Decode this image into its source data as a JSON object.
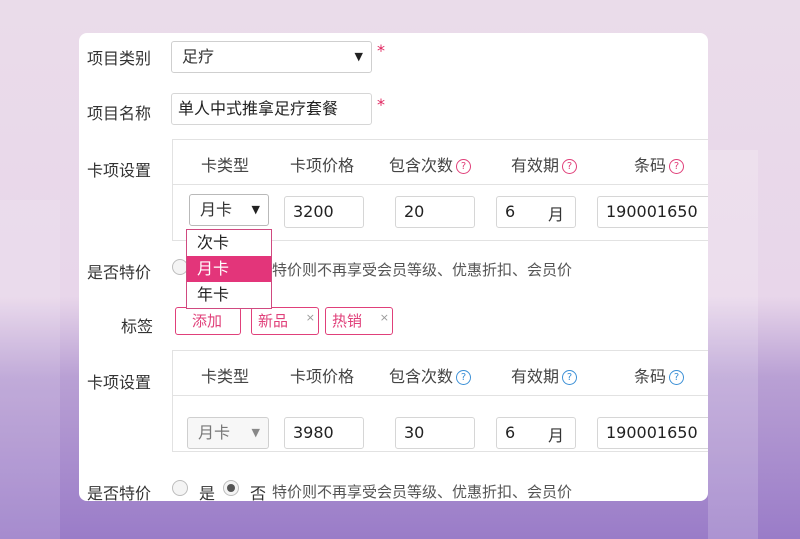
{
  "form": {
    "category_label": "项目类别",
    "category_value": "足疗",
    "name_label": "项目名称",
    "name_value": "单人中式推拿足疗套餐",
    "required_mark": "*",
    "card_settings_label": "卡项设置",
    "special_label": "是否特价",
    "tags_label": "标签",
    "yes_label": "是",
    "no_label": "否",
    "special_hint": "特价则不再享受会员等级、优惠折扣、会员价",
    "special_hint_partial": "特价则不再享受会员等级、优惠折扣、会员价"
  },
  "table_headers": {
    "card_type": "卡类型",
    "price": "卡项价格",
    "count": "包含次数",
    "validity": "有效期",
    "barcode": "条码",
    "help_glyph": "?"
  },
  "cards": [
    {
      "type": "月卡",
      "price": "3200",
      "count": "20",
      "validity": "6",
      "unit": "月",
      "barcode": "190001650"
    },
    {
      "type": "月卡",
      "price": "3980",
      "count": "30",
      "validity": "6",
      "unit": "月",
      "barcode": "190001650"
    }
  ],
  "dropdown_options": [
    "次卡",
    "月卡",
    "年卡"
  ],
  "dropdown_selected": "月卡",
  "tags": {
    "add_label": "添加",
    "items": [
      "新品",
      "热销"
    ],
    "remove_glyph": "×"
  },
  "colors": {
    "accent": "#e0407a",
    "selected_option": "#e3357a",
    "help_icon_blue": "#3a8fd6"
  }
}
